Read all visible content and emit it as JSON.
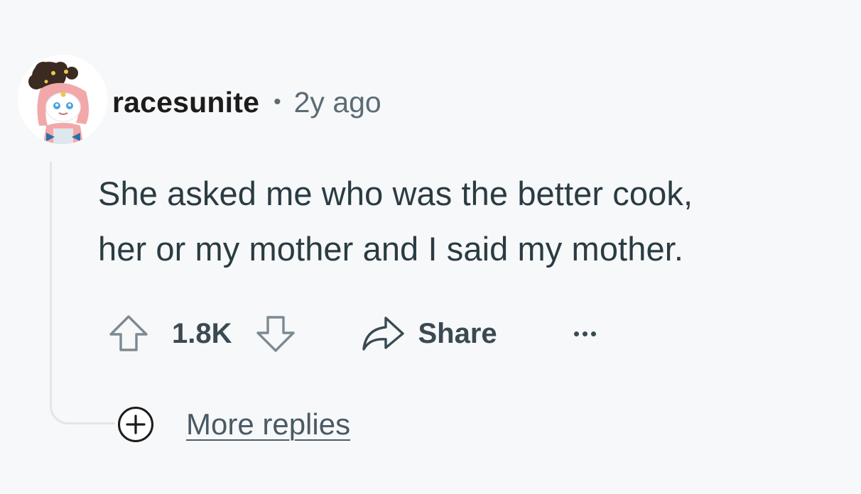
{
  "comment": {
    "username": "racesunite",
    "separator": "•",
    "timestamp": "2y ago",
    "body_lines": [
      "She asked me who was the better cook,",
      "her or my mother and I said my mother."
    ],
    "vote_count": "1.8K",
    "share_label": "Share",
    "more_replies_label": "More replies"
  },
  "icons": {
    "upvote": "arrow-up-icon",
    "downvote": "arrow-down-icon",
    "share": "share-arrow-icon",
    "more": "ellipsis-icon",
    "expand": "plus-circle-icon"
  },
  "colors": {
    "background": "#f7f8fa",
    "username": "#1c1c1c",
    "meta": "#5c6c74",
    "body": "#2a3c42",
    "thread_line": "#e2e5e9"
  }
}
